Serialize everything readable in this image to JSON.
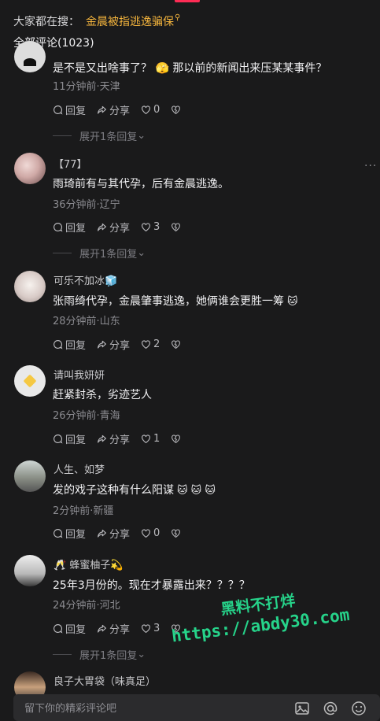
{
  "header": {
    "search_prefix": "大家都在搜：",
    "search_keyword": "金晨被指逃逸骗保",
    "comment_count": "全部评论(1023)"
  },
  "comments": [
    {
      "username": "",
      "text": "是不是又出啥事了？ 🫣 那以前的新闻出来压某某事件？",
      "meta": "11分钟前·天津",
      "likes": "0",
      "expand": "展开1条回复"
    },
    {
      "username": "【77】",
      "text": "雨琦前有与其代孕，后有金晨逃逸。",
      "meta": "36分钟前·辽宁",
      "likes": "3",
      "expand": "展开1条回复"
    },
    {
      "username": "可乐不加冰🧊",
      "text": "张雨绮代孕，金晨肇事逃逸，她俩谁会更胜一筹",
      "emoji": "🐱",
      "meta": "28分钟前·山东",
      "likes": "2"
    },
    {
      "username": "请叫我妍妍",
      "text": "赶紧封杀，劣迹艺人",
      "meta": "26分钟前·青海",
      "likes": "1"
    },
    {
      "username": "人生、如梦",
      "text": "发的戏子这种有什么阳谋",
      "emoji": "🐱 🐱 🐱",
      "meta": "2分钟前·新疆",
      "likes": "0"
    },
    {
      "username": "🥂 蜂蜜柚子💫",
      "text": "25年3月份的。现在才暴露出来？？？？",
      "meta": "24分钟前·河北",
      "likes": "3",
      "expand": "展开1条回复"
    },
    {
      "username": "良子大胃袋（味真足）"
    }
  ],
  "actions": {
    "reply": "回复",
    "share": "分享"
  },
  "more": "···",
  "watermark": {
    "line1": "黑料不打烊",
    "line2": "https://abdy30.com"
  },
  "input": {
    "placeholder": "留下你的精彩评论吧"
  },
  "colors": {
    "accent": "#fe2c55",
    "keyword": "#f5b53d",
    "watermark": "#26d38a",
    "background": "#1a1a1b"
  },
  "icons": [
    "search-icon",
    "reply-icon",
    "share-icon",
    "like-icon",
    "dislike-icon",
    "image-icon",
    "at-icon",
    "emoji-icon"
  ]
}
